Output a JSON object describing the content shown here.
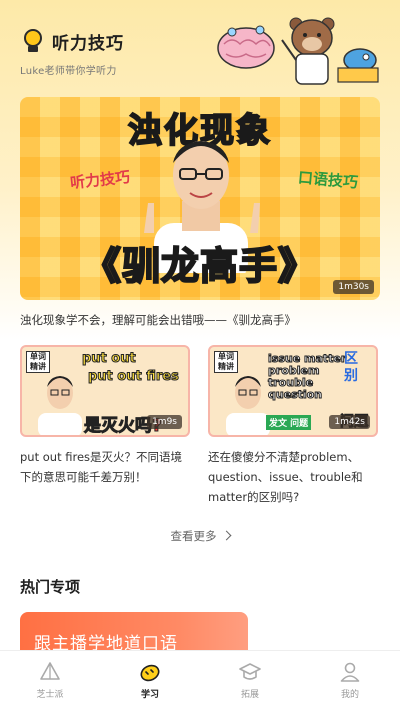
{
  "app": {
    "title": "听力技巧",
    "subtitle": "Luke老师带你学听力"
  },
  "hero": {
    "headline_top": "浊化现象",
    "tag_left": "听力技巧",
    "tag_right": "口语技巧",
    "headline_bottom": "《驯龙高手》",
    "duration": "1m30s",
    "caption": "浊化现象学不会，理解可能会出错哦——《驯龙高手》"
  },
  "videos": [
    {
      "badge": "单词精讲",
      "line1": "put out",
      "line2": "put out fires",
      "line3": "是灭火吗?",
      "duration": "1m9s",
      "caption": "put out fires是灭火？不同语境下的意思可能千差万别！"
    },
    {
      "badge": "单词精讲",
      "overlay": "issue matter problem trouble question",
      "side": "区别",
      "green": "发文 问题",
      "red": "问题",
      "duration": "1m42s",
      "caption": "还在傻傻分不清楚problem、question、issue、trouble和matter的区别吗?"
    }
  ],
  "more_label": "查看更多",
  "section_title": "热门专项",
  "promo": {
    "label": "跟主播学地道口语"
  },
  "tabs": [
    {
      "label": "芝士派",
      "icon": "cheese-icon",
      "active": false
    },
    {
      "label": "学习",
      "icon": "lemon-icon",
      "active": true
    },
    {
      "label": "拓展",
      "icon": "graduation-cap-icon",
      "active": false
    },
    {
      "label": "我的",
      "icon": "person-icon",
      "active": false
    }
  ],
  "colors": {
    "accent": "#ffc61a",
    "promo": "#ff7043",
    "hero_title": "#2fd7c6",
    "hero_subtitle": "#ffe04a"
  }
}
